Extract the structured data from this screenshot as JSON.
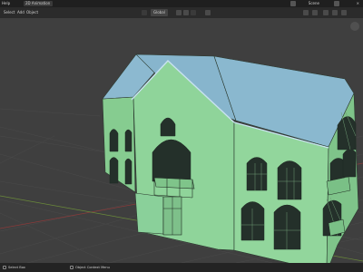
{
  "topbar": {
    "menu_label": "Help",
    "tab_label": "2D Animation",
    "scene_label": "Scene",
    "close_label": "×"
  },
  "header": {
    "select_label": "Select",
    "add_label": "Add",
    "object_label": "Object",
    "orientation_label": "Global"
  },
  "status": {
    "left_label": "Select Box",
    "right_label": "Object Context Menu"
  },
  "colors": {
    "building": "#8fd49a",
    "roof": "#8cb9d0",
    "edges": "#2b3a2f"
  }
}
